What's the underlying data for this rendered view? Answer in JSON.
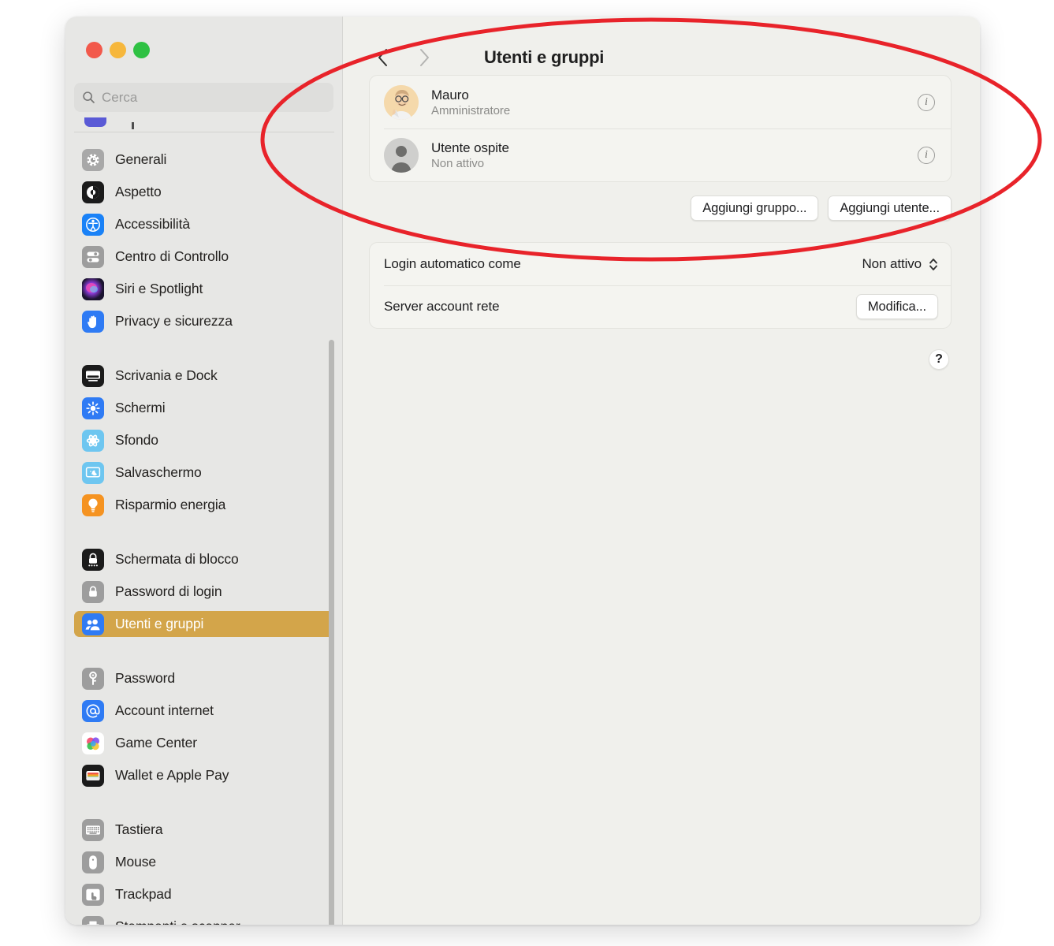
{
  "window": {
    "traffic_lights": [
      "close",
      "minimize",
      "zoom"
    ],
    "colors": {
      "close": "#f2594b",
      "minimize": "#f6b73c",
      "zoom": "#2fc143",
      "sidebar_bg": "#e7e7e5",
      "panel_bg": "#f0f0ec",
      "selection": "#d3a54a",
      "annotation": "#e8232a"
    }
  },
  "search": {
    "placeholder": "Cerca",
    "value": "",
    "icon": "search-icon"
  },
  "sidebar": {
    "groups": [
      {
        "items": [
          {
            "label": "Generali",
            "icon": "gear-icon"
          },
          {
            "label": "Aspetto",
            "icon": "appearance-icon"
          },
          {
            "label": "Accessibilità",
            "icon": "accessibility-icon"
          },
          {
            "label": "Centro di Controllo",
            "icon": "control-center-icon"
          },
          {
            "label": "Siri e Spotlight",
            "icon": "siri-icon"
          },
          {
            "label": "Privacy e sicurezza",
            "icon": "privacy-hand-icon"
          }
        ]
      },
      {
        "items": [
          {
            "label": "Scrivania e Dock",
            "icon": "desktop-dock-icon"
          },
          {
            "label": "Schermi",
            "icon": "displays-icon"
          },
          {
            "label": "Sfondo",
            "icon": "wallpaper-icon"
          },
          {
            "label": "Salvaschermo",
            "icon": "screensaver-icon"
          },
          {
            "label": "Risparmio energia",
            "icon": "energy-bulb-icon"
          }
        ]
      },
      {
        "items": [
          {
            "label": "Schermata di blocco",
            "icon": "lock-screen-icon"
          },
          {
            "label": "Password di login",
            "icon": "login-password-icon"
          },
          {
            "label": "Utenti e gruppi",
            "icon": "users-groups-icon",
            "selected": true
          }
        ]
      },
      {
        "items": [
          {
            "label": "Password",
            "icon": "key-icon"
          },
          {
            "label": "Account internet",
            "icon": "at-sign-icon"
          },
          {
            "label": "Game Center",
            "icon": "game-center-icon"
          },
          {
            "label": "Wallet e Apple Pay",
            "icon": "wallet-icon"
          }
        ]
      },
      {
        "items": [
          {
            "label": "Tastiera",
            "icon": "keyboard-icon"
          },
          {
            "label": "Mouse",
            "icon": "mouse-icon"
          },
          {
            "label": "Trackpad",
            "icon": "trackpad-icon"
          },
          {
            "label": "Stampanti e scanner",
            "icon": "printer-icon"
          }
        ]
      }
    ]
  },
  "header": {
    "title": "Utenti e gruppi",
    "back_icon": "chevron-left-icon",
    "forward_icon": "chevron-right-icon"
  },
  "users": [
    {
      "name": "Mauro",
      "role": "Amministratore",
      "avatar": "memoji-avatar",
      "info_icon": "info-icon"
    },
    {
      "name": "Utente ospite",
      "role": "Non attivo",
      "avatar": "guest-avatar",
      "info_icon": "info-icon"
    }
  ],
  "actions": {
    "add_group": "Aggiungi gruppo...",
    "add_user": "Aggiungi utente..."
  },
  "settings": {
    "auto_login": {
      "label": "Login automatico come",
      "value": "Non attivo",
      "chevron": "up-down-stepper-icon"
    },
    "network_account_server": {
      "label": "Server account rete",
      "button": "Modifica..."
    }
  },
  "help": {
    "label": "?"
  }
}
